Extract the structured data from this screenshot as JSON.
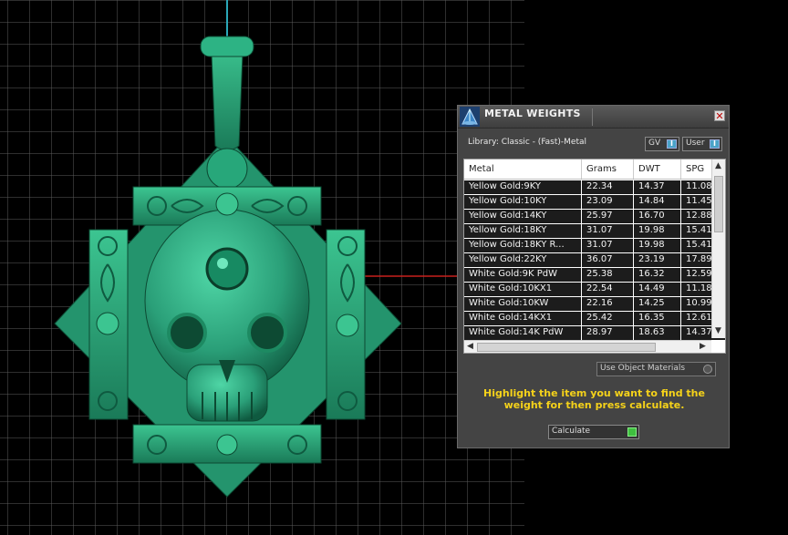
{
  "panel": {
    "title": "METAL WEIGHTS",
    "close_glyph": "✕",
    "library_label": "Library: Classic - (Fast)-Metal",
    "toggles": [
      {
        "label": "GV",
        "indicator": "I"
      },
      {
        "label": "User",
        "indicator": "I"
      }
    ],
    "table": {
      "columns": [
        "Metal",
        "Grams",
        "DWT",
        "SPG"
      ],
      "rows": [
        [
          "Yellow Gold:9KY",
          "22.34",
          "14.37",
          "11.08"
        ],
        [
          "Yellow Gold:10KY",
          "23.09",
          "14.84",
          "11.45"
        ],
        [
          "Yellow Gold:14KY",
          "25.97",
          "16.70",
          "12.88"
        ],
        [
          "Yellow Gold:18KY",
          "31.07",
          "19.98",
          "15.41"
        ],
        [
          "Yellow Gold:18KY R...",
          "31.07",
          "19.98",
          "15.41"
        ],
        [
          "Yellow Gold:22KY",
          "36.07",
          "23.19",
          "17.89"
        ],
        [
          "White Gold:9K PdW",
          "25.38",
          "16.32",
          "12.59"
        ],
        [
          "White Gold:10KX1",
          "22.54",
          "14.49",
          "11.18"
        ],
        [
          "White Gold:10KW",
          "22.16",
          "14.25",
          "10.99"
        ],
        [
          "White Gold:14KX1",
          "25.42",
          "16.35",
          "12.61"
        ],
        [
          "White Gold:14K PdW",
          "28.97",
          "18.63",
          "14.37"
        ]
      ]
    },
    "use_object_materials": "Use Object Materials",
    "hint": "Highlight the item you want to find the weight for then press calculate.",
    "calculate_label": "Calculate"
  },
  "colors": {
    "model_green": "#2a9f78",
    "hint_yellow": "#f5d21a",
    "row_bg": "#1c1c1c",
    "axis_cyan": "#2aa7b8",
    "axis_red": "#c8201c"
  },
  "icons": {
    "app": "metal-weights-scale-icon",
    "close": "close-icon",
    "calculate": "play-icon",
    "scroll_up": "chevron-up-icon",
    "scroll_down": "chevron-down-icon",
    "scroll_left": "chevron-left-icon",
    "scroll_right": "chevron-right-icon"
  }
}
